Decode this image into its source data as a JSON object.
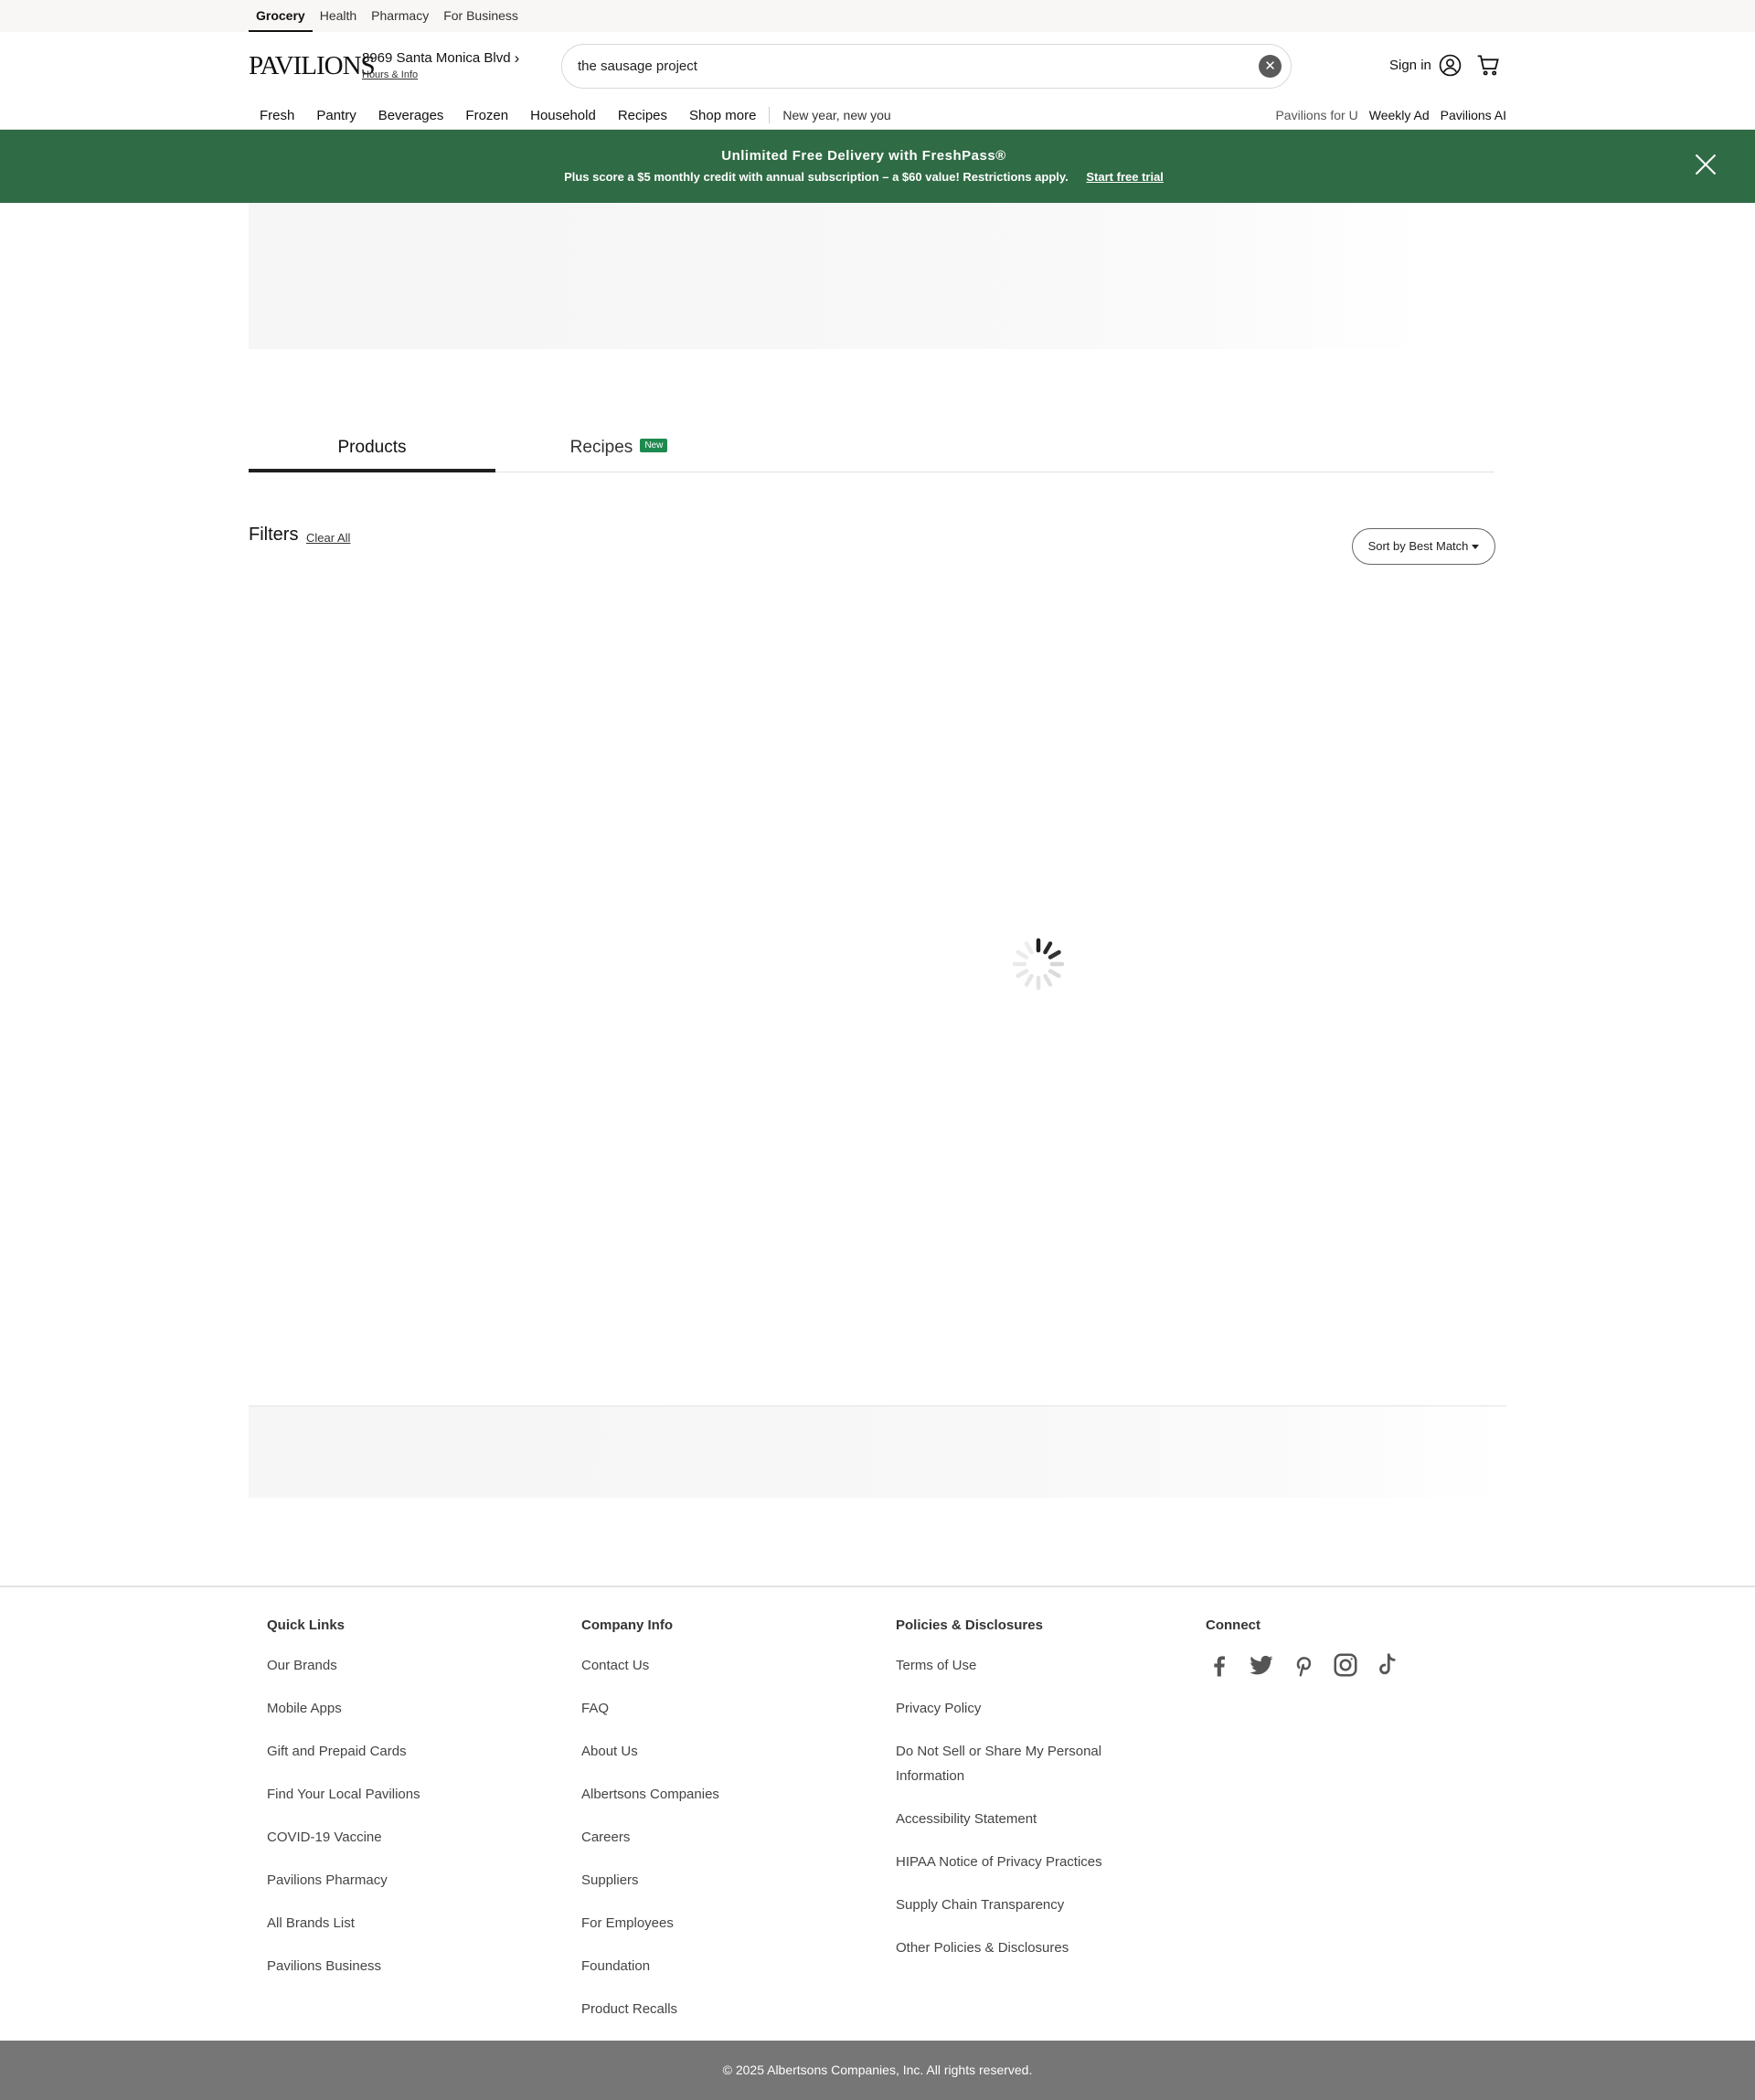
{
  "topbar": {
    "items": [
      "Grocery",
      "Health",
      "Pharmacy",
      "For Business"
    ]
  },
  "header": {
    "logo": "PAVILIONS",
    "store_name": "8969 Santa Monica Blvd",
    "store_hours": "Hours & Info",
    "search_value": "the sausage project",
    "signin": "Sign in"
  },
  "catnav": {
    "items": [
      "Fresh",
      "Pantry",
      "Beverages",
      "Frozen",
      "Household",
      "Recipes",
      "Shop more"
    ],
    "promo": "New year, new you"
  },
  "rightnav": {
    "items": [
      "Pavilions for U",
      "Weekly Ad",
      "Pavilions AI"
    ]
  },
  "banner": {
    "title": "Unlimited Free Delivery with FreshPass®",
    "subtitle": "Plus score a $5 monthly credit with annual subscription – a $60 value! Restrictions apply.",
    "link": "Start free trial",
    "background": "#2f6b44"
  },
  "tabs": {
    "products": "Products",
    "recipes": "Recipes",
    "recipes_badge": "New"
  },
  "filters": {
    "title": "Filters",
    "clear_all": "Clear All",
    "sort": "Sort by Best Match"
  },
  "footer": {
    "quick_links": {
      "title": "Quick Links",
      "links": [
        "Our Brands",
        "Mobile Apps",
        "Gift and Prepaid Cards",
        "Find Your Local Pavilions",
        "COVID-19 Vaccine",
        "Pavilions Pharmacy",
        "All Brands List",
        "Pavilions Business"
      ]
    },
    "company_info": {
      "title": "Company Info",
      "links": [
        "Contact Us",
        "FAQ",
        "About Us",
        "Albertsons Companies",
        "Careers",
        "Suppliers",
        "For Employees",
        "Foundation",
        "Product Recalls"
      ]
    },
    "policies": {
      "title": "Policies & Disclosures",
      "links": [
        "Terms of Use",
        "Privacy Policy",
        "Do Not Sell or Share My Personal Information",
        "Accessibility Statement",
        "HIPAA Notice of Privacy Practices",
        "Supply Chain Transparency",
        "Other Policies & Disclosures"
      ]
    },
    "connect": {
      "title": "Connect",
      "icons": [
        "facebook-icon",
        "twitter-icon",
        "pinterest-icon",
        "instagram-icon",
        "tiktok-icon"
      ]
    },
    "copyright": "© 2025 Albertsons Companies, Inc.  All rights reserved."
  }
}
